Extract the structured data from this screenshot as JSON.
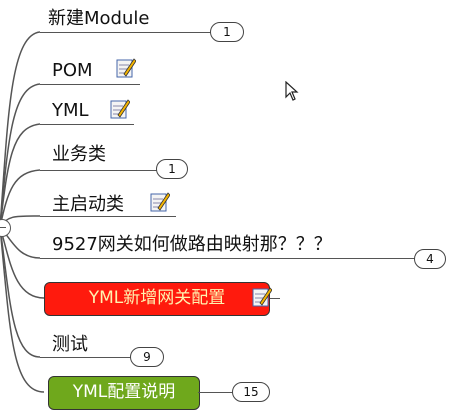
{
  "nodes": [
    {
      "label": "新建Module",
      "badge": "1",
      "note": false
    },
    {
      "label": "POM",
      "badge": "",
      "note": true
    },
    {
      "label": "YML",
      "badge": "",
      "note": true
    },
    {
      "label": "业务类",
      "badge": "1",
      "note": false
    },
    {
      "label": "主启动类",
      "badge": "",
      "note": true
    },
    {
      "label": "9527网关如何做路由映射那？？？",
      "badge": "4",
      "note": false
    },
    {
      "label": "YML新增网关配置",
      "badge": "",
      "note": true
    },
    {
      "label": "测试",
      "badge": "9",
      "note": false
    },
    {
      "label": "YML配置说明",
      "badge": "15",
      "note": false
    }
  ],
  "colors": {
    "red_node": "#ff1a0d",
    "red_node_text": "#fff3b0",
    "green_node": "#6fa81c",
    "line": "#555555"
  },
  "icons": {
    "note": "note-pencil-icon",
    "collapse": "collapse-minus-icon",
    "cursor": "mouse-cursor-icon"
  }
}
